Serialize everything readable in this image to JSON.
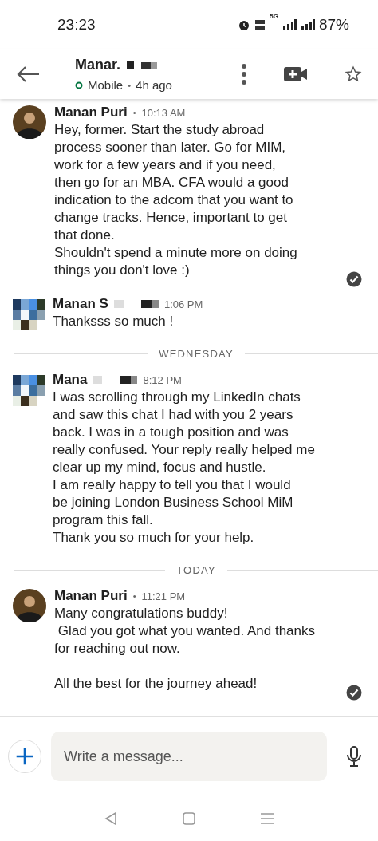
{
  "status_bar": {
    "time": "23:23",
    "network": "5G",
    "battery": "87%"
  },
  "header": {
    "name": "Manar.",
    "name_redacted": true,
    "presence": "Mobile",
    "separator": "•",
    "online": true,
    "last_seen": "4h ago"
  },
  "messages": [
    {
      "kind": "message",
      "sender": "Manan Puri",
      "redacted": false,
      "separator": "•",
      "time": "10:13 AM",
      "avatar": {
        "kind": "photo"
      },
      "read": true,
      "text": "Hey, former. Start the study abroad\nprocess sooner than later. Go for MIM,\nwork for a few years and if you need,\nthen go for an MBA. CFA would a good\nindication to the adcom that you want to\nchange tracks. Hence, important to get\nthat done.\nShouldn't spend a minute more on doing\nthings you don't love :)"
    },
    {
      "kind": "message",
      "sender": "Manan S",
      "redacted": true,
      "time": "1:06 PM",
      "avatar": {
        "kind": "pixelated"
      },
      "read": false,
      "text": "Thanksss so much !"
    },
    {
      "kind": "day_divider",
      "label": "WEDNESDAY"
    },
    {
      "kind": "message",
      "sender": "Mana",
      "redacted": true,
      "time": "8:12 PM",
      "avatar": {
        "kind": "pixelated"
      },
      "read": false,
      "text": "I was scrolling through my LinkedIn chats\nand saw this chat I had with you 2 years\nback. I was in a tough position and was\nreally confused. Your reply really helped me\nclear up my mind, focus and hustle.\nI am really happy to tell you that I would\nbe joining London Business School MiM\nprogram this fall.\nThank you so much for your help."
    },
    {
      "kind": "day_divider",
      "label": "TODAY"
    },
    {
      "kind": "message",
      "sender": "Manan Puri",
      "redacted": false,
      "separator": "•",
      "time": "11:21 PM",
      "avatar": {
        "kind": "photo"
      },
      "read": true,
      "text": "Many congratulations buddy!\n Glad you got what you wanted. And thanks\nfor reaching out now.\n\nAll the best for the journey ahead!"
    }
  ],
  "composer": {
    "placeholder": "Write a message..."
  }
}
